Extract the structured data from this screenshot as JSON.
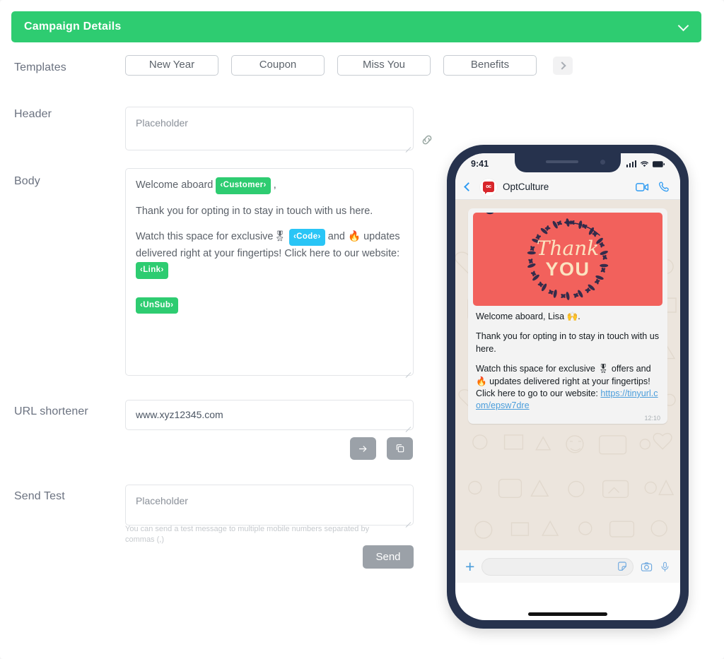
{
  "panel": {
    "title": "Campaign Details",
    "collapse_icon": "chevron-down-icon",
    "accent_color": "#2ECC71"
  },
  "form": {
    "templates": {
      "label": "Templates",
      "options": [
        "New Year",
        "Coupon",
        "Miss You",
        "Benefits"
      ],
      "next_icon": "chevron-right-icon"
    },
    "header": {
      "label": "Header",
      "value": "",
      "placeholder": "Placeholder",
      "link_icon": "link-icon"
    },
    "body": {
      "label": "Body",
      "line1_pre": "Welcome aboard",
      "tag_customer": "‹Customer›",
      "line1_post": ",",
      "line2": "Thank you for opting in to stay in touch with us here.",
      "line3_pre": "Watch this space for exclusive🎖",
      "tag_code": "‹Code›",
      "line3_mid": "and 🔥 updates delivered right at your fingertips! Click here to our website:",
      "tag_link": "‹Link›",
      "tag_unsub": "‹UnSub›"
    },
    "url_shortener": {
      "label": "URL shortener",
      "value": "www.xyz12345.com",
      "go_icon": "arrow-right-icon",
      "copy_icon": "copy-icon"
    },
    "send_test": {
      "label": "Send Test",
      "value": "",
      "placeholder": "Placeholder",
      "helper": "You can send a test message to multiple mobile numbers separated by commas (,)",
      "send_label": "Send"
    }
  },
  "preview": {
    "status_time": "9:41",
    "signal_icon": "cellular-signal-icon",
    "wifi_icon": "wifi-icon",
    "battery_icon": "battery-icon",
    "back_icon": "back-chevron-icon",
    "avatar_text": "oc",
    "contact_name": "OptCulture",
    "video_icon": "video-call-icon",
    "call_icon": "phone-call-icon",
    "card": {
      "script_text": "Thank",
      "block_text": "YOU",
      "bg_color": "#F2615C",
      "text_color": "#FBE3C0"
    },
    "message": {
      "line1": "Welcome aboard, Lisa 🙌.",
      "line2": "Thank you for opting in to stay in touch with us here.",
      "line3": "Watch this space for exclusive 🎖 offers and 🔥 updates delivered right at your fingertips! Click here to go to our website:",
      "link": "https://tinyurl.com/epsw7dre",
      "time": "12:10"
    },
    "input_bar": {
      "plus_icon": "plus-icon",
      "sticker_icon": "sticker-icon",
      "camera_icon": "camera-icon",
      "mic_icon": "microphone-icon"
    }
  }
}
